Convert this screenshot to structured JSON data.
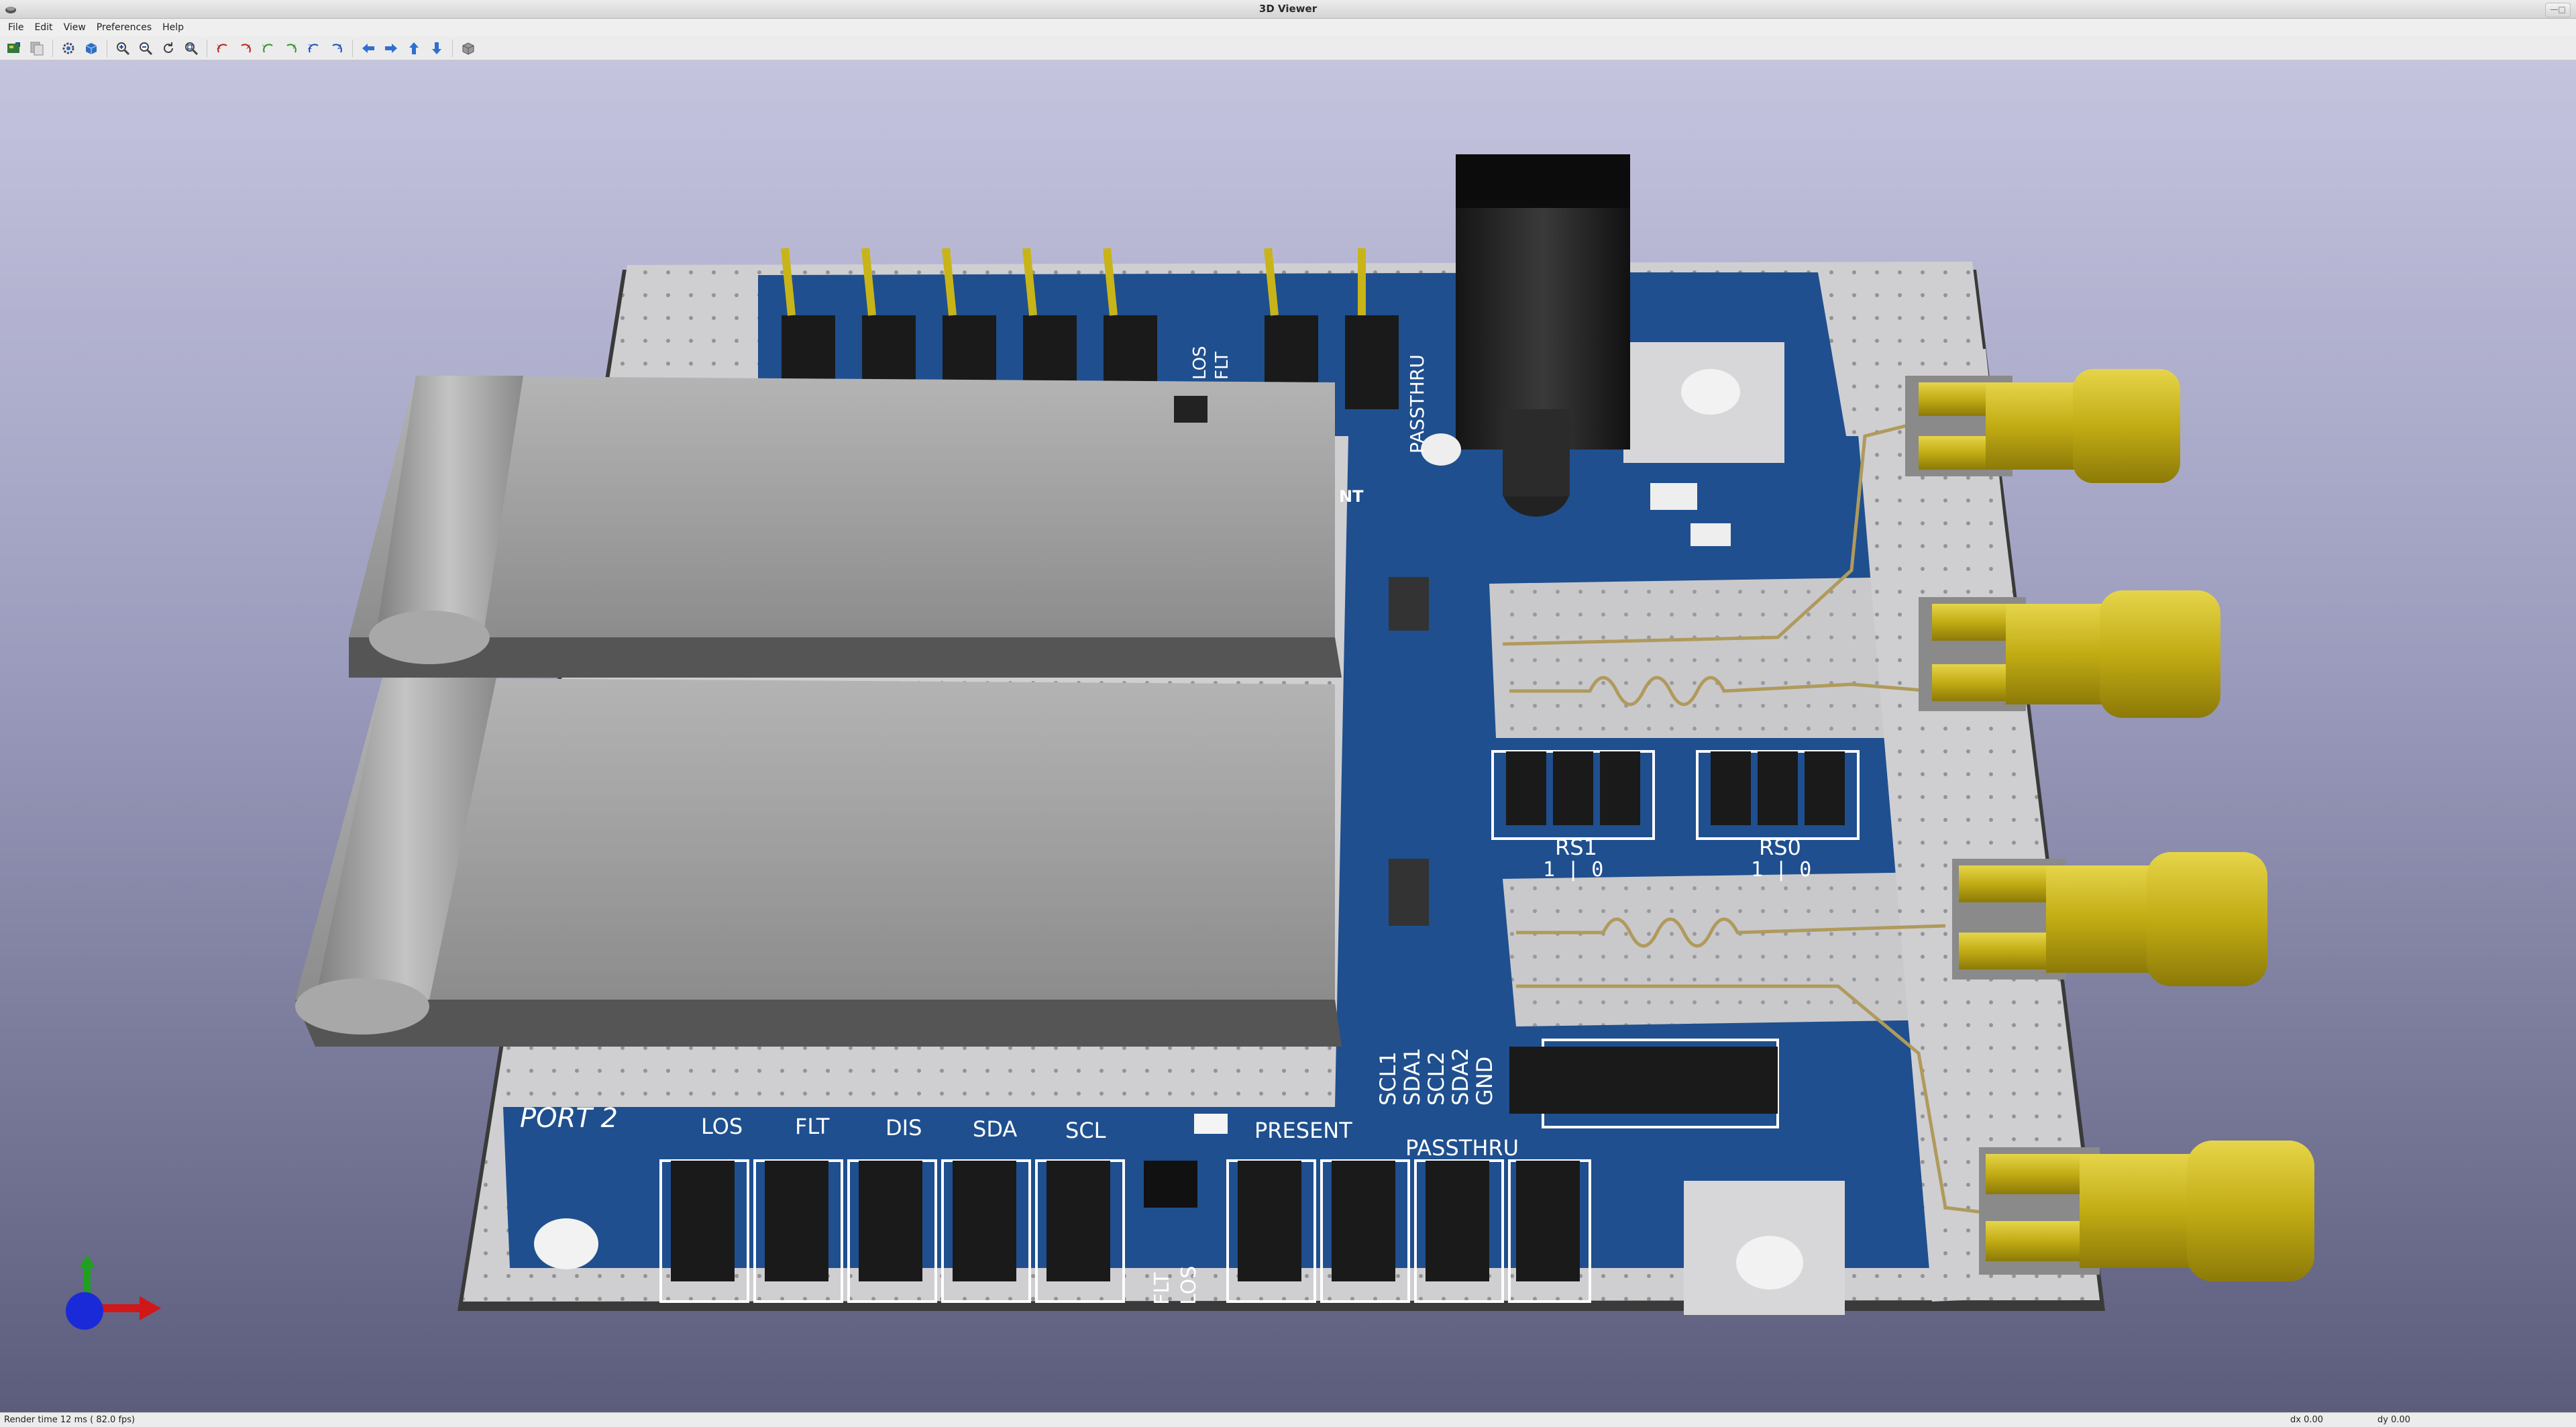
{
  "window": {
    "title": "3D Viewer"
  },
  "menubar": {
    "items": [
      "File",
      "Edit",
      "View",
      "Preferences",
      "Help"
    ]
  },
  "toolbar": {
    "buttons": [
      "reload-board-icon",
      "copy-image-icon",
      "preferences-icon",
      "render-mode-icon",
      "zoom-in-icon",
      "zoom-out-icon",
      "zoom-redraw-icon",
      "zoom-fit-icon",
      "rotate-x-cw-icon",
      "rotate-x-ccw-icon",
      "rotate-y-cw-icon",
      "rotate-y-ccw-icon",
      "rotate-z-cw-icon",
      "rotate-z-ccw-icon",
      "pan-left-icon",
      "pan-right-icon",
      "pan-up-icon",
      "pan-down-icon",
      "ortho-toggle-icon"
    ]
  },
  "board": {
    "labels": {
      "port2": "PORT 2",
      "los": "LOS",
      "flt": "FLT",
      "dis": "DIS",
      "sda": "SDA",
      "scl": "SCL",
      "present": "PRESENT",
      "passthru_bottom": "PASSTHRU",
      "passthru_top": "PASSTHRU",
      "flt_v": "FLT",
      "los_v": "LOS",
      "los_top": "LOS",
      "flt_top": "FLT",
      "rs1": "RS1",
      "rs0": "RS0",
      "rs_sel": "1 | 0",
      "scl1": "SCL1",
      "sda1": "SDA1",
      "scl2": "SCL2",
      "sda2": "SDA2",
      "gnd": "GND",
      "nt": "NT"
    }
  },
  "status": {
    "render_time": "Render time 12 ms ( 82.0 fps)",
    "dx": "dx 0.00",
    "dy": "dy 0.00"
  },
  "colors": {
    "pcb_blue": "#1f4f8e",
    "copper_silver": "#c9c9cc",
    "gold": "#c8b418",
    "sfp_gray": "#9a9a9a"
  }
}
